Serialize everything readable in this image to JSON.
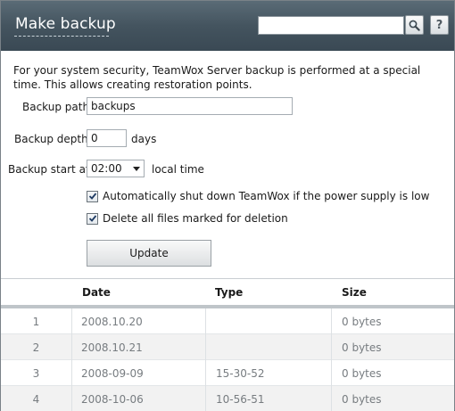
{
  "header": {
    "title": "Make backup",
    "search_placeholder": "",
    "search_icon": "magnifier-icon",
    "help_label": "?"
  },
  "form": {
    "intro": "For your system security, TeamWox Server backup is performed at a special time. This allows creating restoration points.",
    "backup_path_label": "Backup path",
    "backup_path_value": "backups",
    "backup_depth_label": "Backup depth",
    "backup_depth_value": "0",
    "backup_depth_unit": "days",
    "backup_start_label": "Backup start at",
    "backup_start_value": "02:00",
    "backup_start_unit": "local time",
    "shutdown_label": "Automatically shut down TeamWox if the power supply is low",
    "shutdown_checked": true,
    "delete_label": "Delete all files marked for deletion",
    "delete_checked": true,
    "update_label": "Update"
  },
  "table": {
    "columns": [
      "Date",
      "Type",
      "Size"
    ],
    "rows": [
      {
        "num": "1",
        "date": "2008.10.20",
        "type": "",
        "size": "0 bytes"
      },
      {
        "num": "2",
        "date": "2008.10.21",
        "type": "",
        "size": "0 bytes"
      },
      {
        "num": "3",
        "date": "2008-09-09",
        "type": "15-30-52",
        "size": "0 bytes"
      },
      {
        "num": "4",
        "date": "2008-10-06",
        "type": "10-56-51",
        "size": "0 bytes"
      }
    ]
  }
}
